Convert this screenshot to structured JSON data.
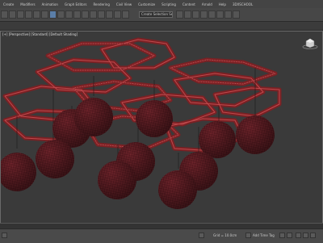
{
  "menu": {
    "items": [
      "Create",
      "Modifiers",
      "Animation",
      "Graph Editors",
      "Rendering",
      "Civil View",
      "Customize",
      "Scripting",
      "Content",
      "Arnold",
      "Help",
      "3DXSCHOOL"
    ]
  },
  "toolbar": {
    "selection_filter": "Create Selection Set"
  },
  "viewport": {
    "label": "[+] [Perspective] [Standard] [Default Shading]"
  },
  "statusbar": {
    "grid": "Grid = 10.0cm",
    "tag": "Add Time Tag"
  },
  "colors": {
    "wood": "#7a2124",
    "wood_edge": "#c0484c",
    "globe": "#5a1a20",
    "background": "#3a3a3a"
  }
}
